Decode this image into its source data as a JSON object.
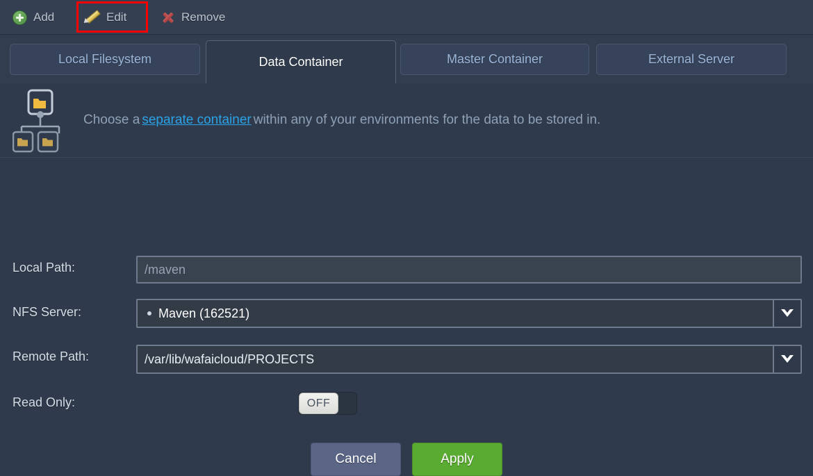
{
  "toolbar": {
    "buttons": [
      {
        "label": "Add",
        "icon": "plus-circle-icon"
      },
      {
        "label": "Edit",
        "icon": "pencil-icon"
      },
      {
        "label": "Remove",
        "icon": "cross-icon"
      }
    ],
    "highlight": {
      "target": "Edit",
      "color": "#fe0000"
    }
  },
  "tabs": [
    {
      "label": "Local Filesystem",
      "active": false
    },
    {
      "label": "Data Container",
      "active": true
    },
    {
      "label": "Master Container",
      "active": false
    },
    {
      "label": "External Server",
      "active": false
    }
  ],
  "banner": {
    "icon": "container-tree-icon",
    "text_before": "Choose a",
    "link": "separate container",
    "text_after": "within any of your environments for the data to be stored in."
  },
  "form": {
    "local_path": {
      "label": "Local Path:",
      "value": "/maven"
    },
    "nfs_server": {
      "label": "NFS Server:",
      "value": "Maven (162521)",
      "bullet": true
    },
    "remote_path": {
      "label": "Remote Path:",
      "value": "/var/lib/wafaicloud/PROJECTS"
    },
    "read_only": {
      "label": "Read Only:",
      "state": "OFF"
    }
  },
  "actions": {
    "cancel": "Cancel",
    "apply": "Apply"
  },
  "colors": {
    "background": "#2f3b4c",
    "toolbar": "#353f52",
    "tab_inactive_text": "#9bb6d8",
    "link": "#2aa3e8",
    "apply_green": "#5aab31",
    "cancel_blue": "#5b6687",
    "highlight_red": "#fe0000"
  }
}
